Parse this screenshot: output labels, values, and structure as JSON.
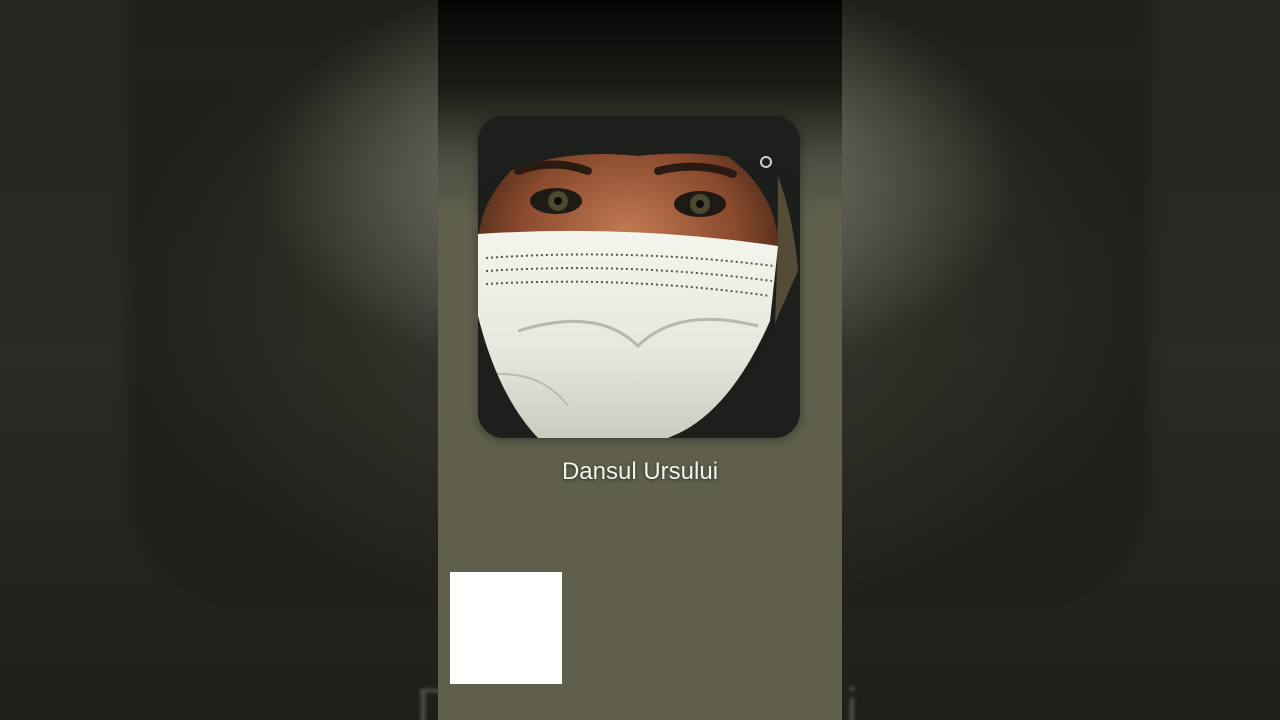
{
  "track": {
    "title": "Dansul Ursului"
  },
  "backdrop": {
    "blurred_title": "Dansul Ursului"
  },
  "colors": {
    "panel": "#5f5f4c",
    "mask": "#e9ece3",
    "hood": "#1d1f1d",
    "skin": "#b8704a"
  },
  "icons": {
    "cover_art": "masked-face-image",
    "placeholder": "white-square"
  }
}
